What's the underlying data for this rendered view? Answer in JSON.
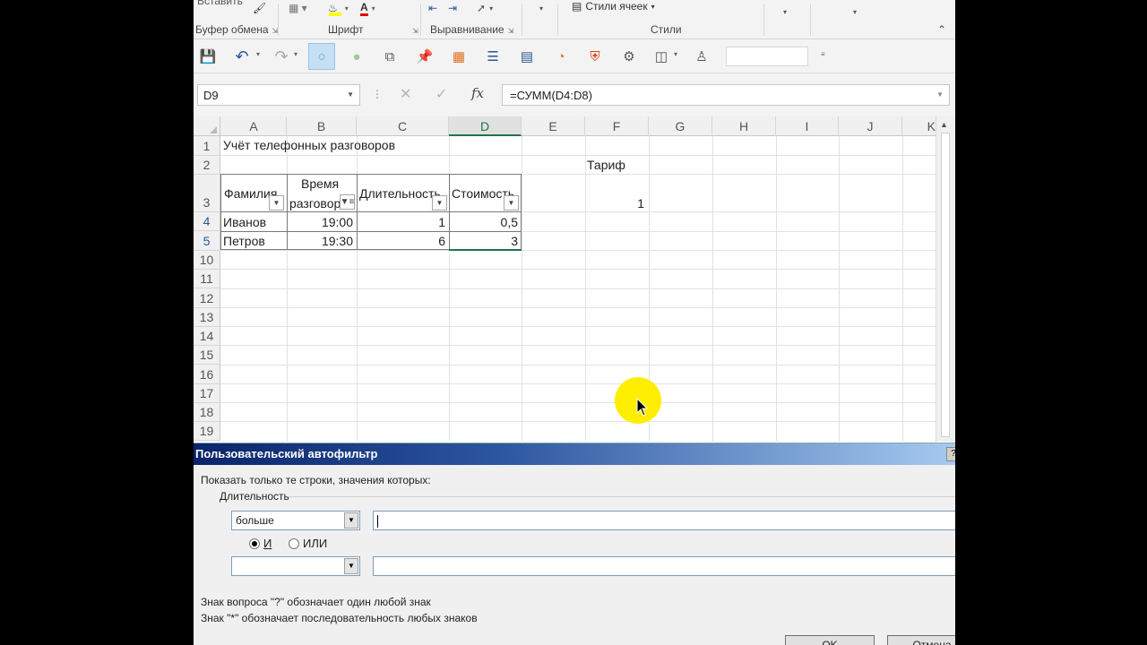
{
  "ribbon": {
    "top_partial": "Вставить",
    "font_color_letter": "A",
    "cell_styles": "Стили ячеек",
    "groups": {
      "clipboard": "Буфер обмена",
      "font": "Шрифт",
      "alignment": "Выравнивание",
      "styles": "Стили"
    }
  },
  "namebox": "D9",
  "formula": "=СУММ(D4:D8)",
  "fx_label": "fx",
  "columns": [
    "A",
    "B",
    "C",
    "D",
    "E",
    "F",
    "G",
    "H",
    "I",
    "J",
    "K"
  ],
  "rows": [
    "1",
    "2",
    "3",
    "4",
    "5",
    "10",
    "11",
    "12",
    "13",
    "14",
    "15",
    "16",
    "17",
    "18",
    "19"
  ],
  "sheet": {
    "title": "Учёт телефонных разговоров",
    "tariff_label": "Тариф",
    "tariff_value": "1",
    "headers": {
      "a": "Фамилия",
      "b_line1": "Время",
      "b_line2": "разговора",
      "c": "Длительность",
      "d": "Стоимость"
    },
    "data": [
      {
        "a": "Иванов",
        "b": "19:00",
        "c": "1",
        "d": "0,5"
      },
      {
        "a": "Петров",
        "b": "19:30",
        "c": "6",
        "d": "3"
      }
    ]
  },
  "dialog": {
    "title": "Пользовательский автофильтр",
    "instruction": "Показать только те строки, значения которых:",
    "field": "Длительность",
    "cond1": "больше",
    "cond1_value": "",
    "cond2": "",
    "cond2_value": "",
    "and_label": "И",
    "or_label": "ИЛИ",
    "hint1": "Знак вопроса \"?\" обозначает один любой знак",
    "hint2": "Знак \"*\" обозначает последовательность любых знаков",
    "ok": "OK",
    "cancel": "Отмена"
  },
  "colors": {
    "accent_green": "#217346",
    "title_bar": "#0a246a",
    "cursor_highlight": "#ffee00"
  }
}
